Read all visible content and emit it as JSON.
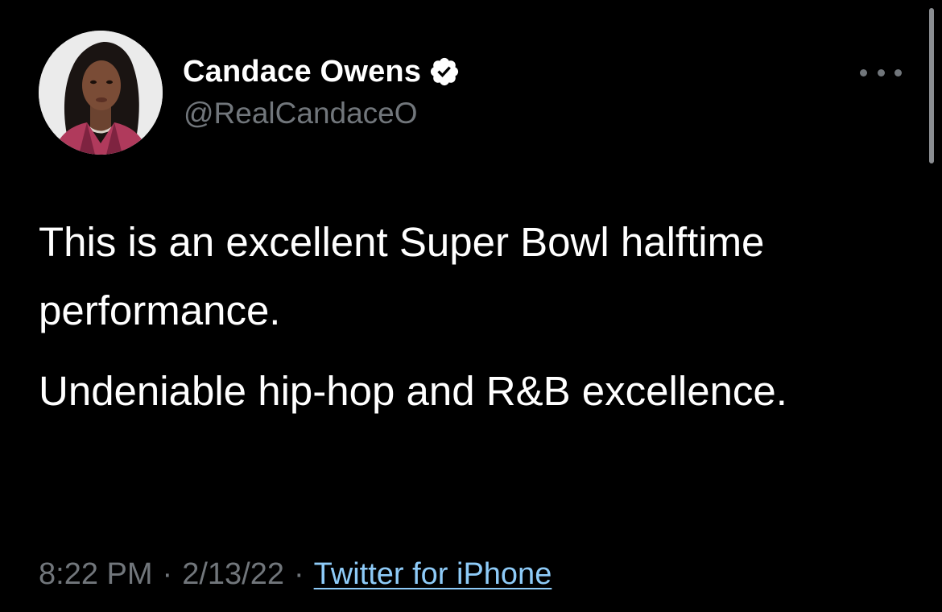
{
  "tweet": {
    "author": {
      "display_name": "Candace Owens",
      "handle": "@RealCandaceO",
      "verified": true,
      "avatar_icon": "profile-photo",
      "verified_icon": "verified-badge-icon"
    },
    "more_icon": "more-options-icon",
    "paragraphs": [
      "This is an excellent Super Bowl halftime performance.",
      "Undeniable hip-hop and R&B excellence."
    ],
    "time": "8:22 PM",
    "date": "2/13/22",
    "separator": "·",
    "source": "Twitter for iPhone"
  },
  "colors": {
    "background": "#000000",
    "text": "#ffffff",
    "secondary_text": "#71767b",
    "link": "#8ecbf8"
  }
}
